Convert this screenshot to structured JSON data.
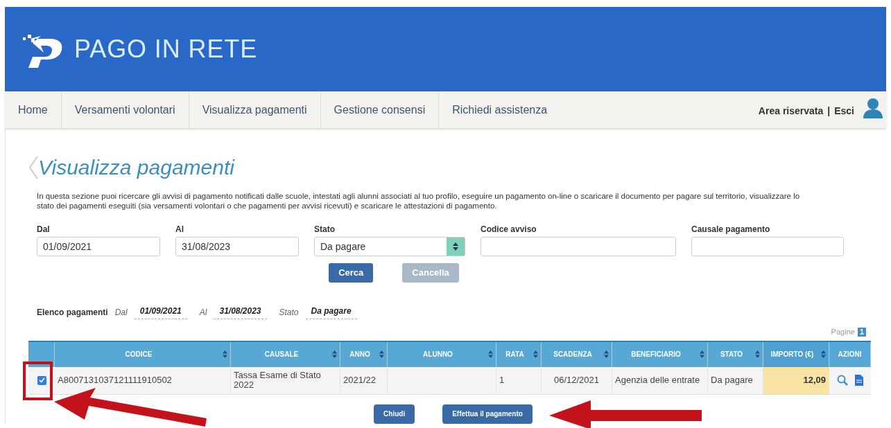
{
  "header": {
    "brand": "PAGO IN RETE"
  },
  "nav": {
    "items": [
      {
        "label": "Home"
      },
      {
        "label": "Versamenti volontari"
      },
      {
        "label": "Visualizza pagamenti"
      },
      {
        "label": "Gestione consensi"
      },
      {
        "label": "Richiedi assistenza"
      }
    ],
    "area": "Area riservata",
    "separator": "|",
    "logout": "Esci"
  },
  "page": {
    "title": "Visualizza pagamenti",
    "description": "In questa sezione puoi ricercare gli avvisi di pagamento notificati dalle scuole, intestati agli alunni associati al tuo profilo, eseguire un pagamento on-line o scaricare il documento per pagare sul territorio, visualizzare lo stato dei pagamenti eseguiti (sia versamenti volontari o che pagamenti per avvisi ricevuti) e scaricare le attestazioni di pagamento."
  },
  "filters": [
    {
      "label": "Dal",
      "value": "01/09/2021",
      "kind": "text"
    },
    {
      "label": "Al",
      "value": "31/08/2023",
      "kind": "text"
    },
    {
      "label": "Stato",
      "value": "Da pagare",
      "kind": "select"
    },
    {
      "label": "Codice avviso",
      "kind": "text"
    },
    {
      "label": "Causale pagamento",
      "kind": "text"
    }
  ],
  "search_buttons": [
    {
      "label": "Cerca",
      "disabled": false
    },
    {
      "label": "Cancella",
      "disabled": true
    }
  ],
  "summary": {
    "title": "Elenco pagamenti",
    "items": [
      {
        "label": "Dal",
        "value": "01/09/2021"
      },
      {
        "label": "Al",
        "value": "31/08/2023"
      },
      {
        "label": "Stato",
        "value": "Da pagare"
      }
    ]
  },
  "pagination": {
    "label": "Pagine",
    "pages": [
      "1"
    ]
  },
  "table": {
    "columns": [
      {
        "label": "CODICE",
        "sortable": true
      },
      {
        "label": "CAUSALE",
        "sortable": true
      },
      {
        "label": "ANNO",
        "sortable": true
      },
      {
        "label": "ALUNNO",
        "sortable": true
      },
      {
        "label": "RATA",
        "sortable": true
      },
      {
        "label": "SCADENZA",
        "sortable": true
      },
      {
        "label": "BENEFICIARIO",
        "sortable": true
      },
      {
        "label": "STATO",
        "sortable": true
      },
      {
        "label": "IMPORTO (€)",
        "sortable": true
      },
      {
        "label": "AZIONI",
        "sortable": false
      }
    ],
    "rows": [
      {
        "checked": true,
        "cells": [
          "A8007131037121111910502",
          "Tassa Esame di Stato 2022",
          "2021/22",
          "",
          "1",
          "06/12/2021",
          "Agenzia delle entrate",
          "Da pagare",
          "12,09"
        ]
      }
    ]
  },
  "actions": [
    {
      "label": "Chiudi"
    },
    {
      "label": "Effettua il pagamento"
    }
  ]
}
